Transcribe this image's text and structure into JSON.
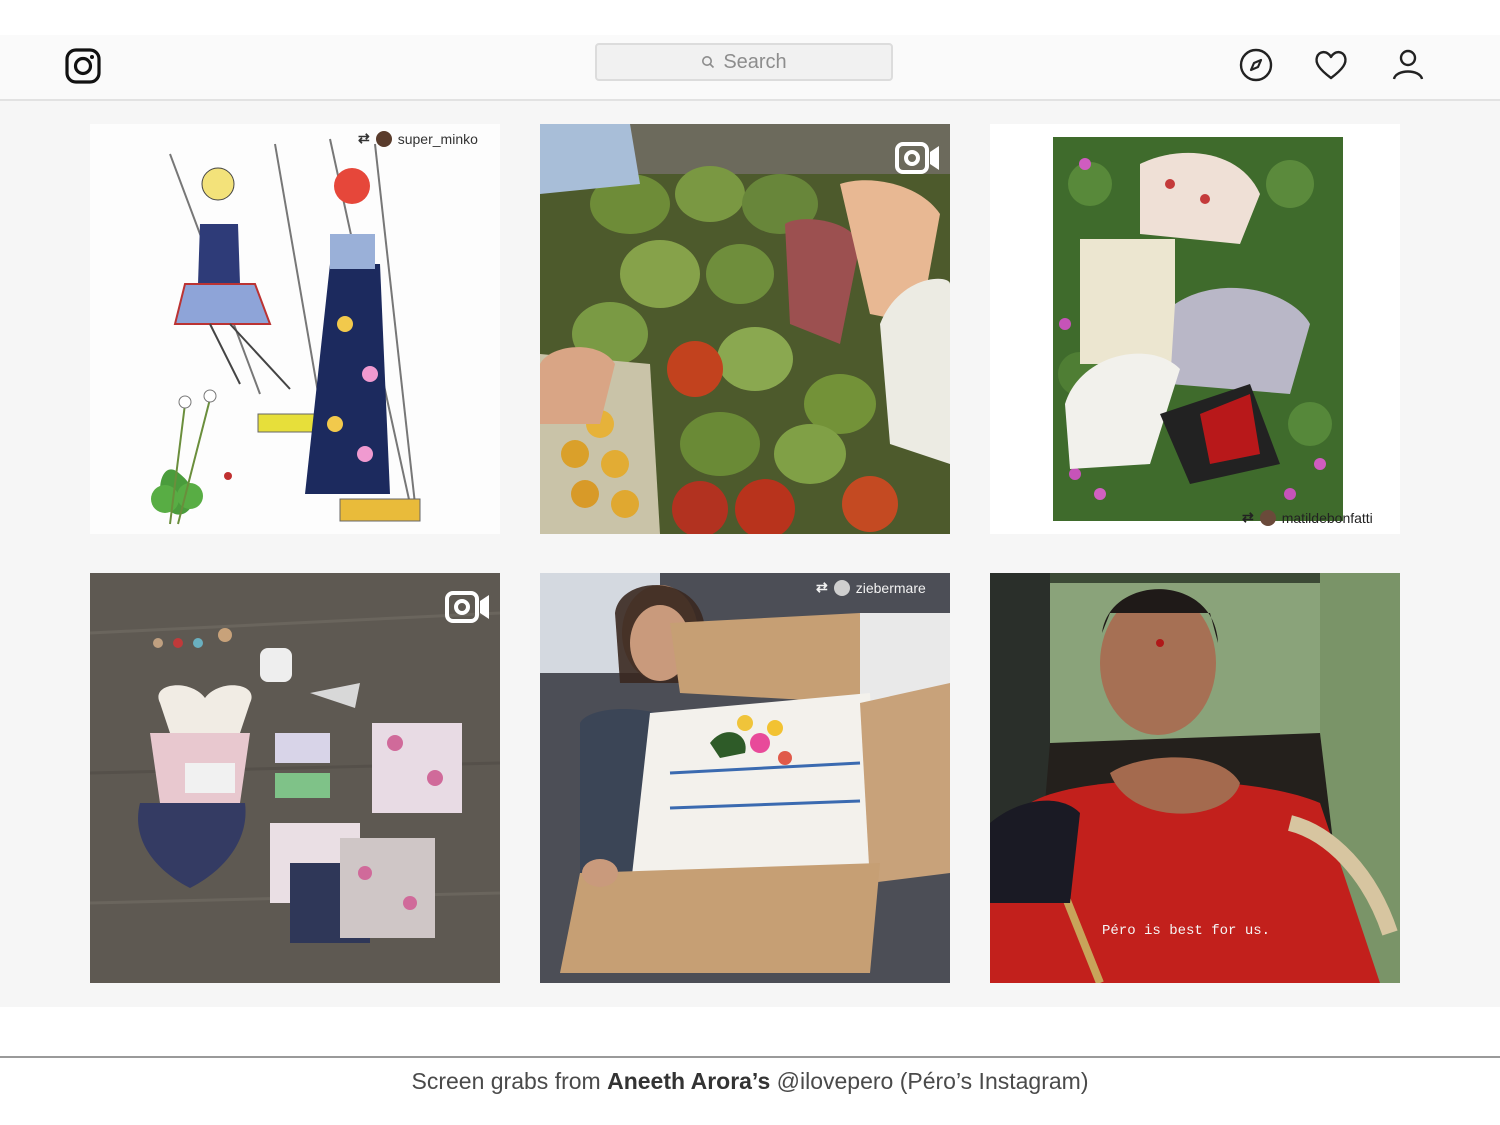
{
  "header": {
    "search_placeholder": "Search"
  },
  "icons": {
    "logo": "instagram-logo-icon",
    "explore": "compass-icon",
    "activity": "heart-icon",
    "profile": "user-icon"
  },
  "posts": [
    {
      "type": "repost",
      "repost_user": "super_minko",
      "media": "illustration"
    },
    {
      "type": "video",
      "media": "photo"
    },
    {
      "type": "repost",
      "repost_user": "matildebonfatti",
      "media": "photo"
    },
    {
      "type": "video",
      "media": "photo"
    },
    {
      "type": "repost",
      "repost_user": "ziebermare",
      "media": "photo"
    },
    {
      "type": "video",
      "media": "photo",
      "subtitle": "Péro is best for us."
    }
  ],
  "footer": {
    "prefix": "Screen grabs from ",
    "name": "Aneeth Arora’s",
    "suffix": " @ilovepero (Péro’s Instagram)"
  }
}
